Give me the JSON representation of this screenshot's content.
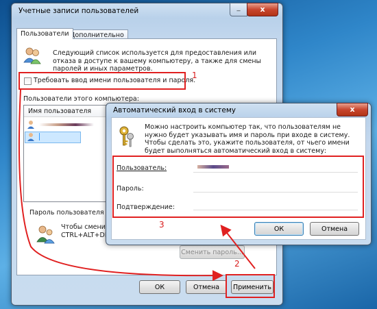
{
  "main_window": {
    "title": "Учетные записи пользователей",
    "close": "x",
    "tabs": [
      {
        "label": "Пользователи"
      },
      {
        "label": "Дополнительно"
      }
    ],
    "description": "Следующий список используется для предоставления или отказа в доступе к вашему компьютеру, а также для смены паролей и иных параметров.",
    "require_password_checkbox": "Требовать ввод имени пользователя и пароля.",
    "users_group_label": "Пользователи этого компьютера:",
    "column_username": "Имя пользователя",
    "password_section_label": "Пароль пользователя И",
    "password_hint": "Чтобы смени\nCTRL+ALT+DE",
    "change_password_button": "Сменить пароль...",
    "ok_button": "ОК",
    "cancel_button": "Отмена",
    "apply_button": "Применить"
  },
  "dialog": {
    "title": "Автоматический вход в систему",
    "close": "x",
    "message": "Можно настроить компьютер так, что пользователям не нужно будет указывать имя и пароль при входе в систему. Чтобы сделать это, укажите пользователя, от чьего имени будет выполняться автоматический вход в систему:",
    "user_label": "Пользователь:",
    "password_label": "Пароль:",
    "confirm_label": "Подтверждение:",
    "ok_button": "ОК",
    "cancel_button": "Отмена"
  },
  "annotations": {
    "n1": "1",
    "n2": "2",
    "n3": "3"
  },
  "colors": {
    "annotation_red": "#e02020",
    "selection_blue": "#3399ff"
  }
}
